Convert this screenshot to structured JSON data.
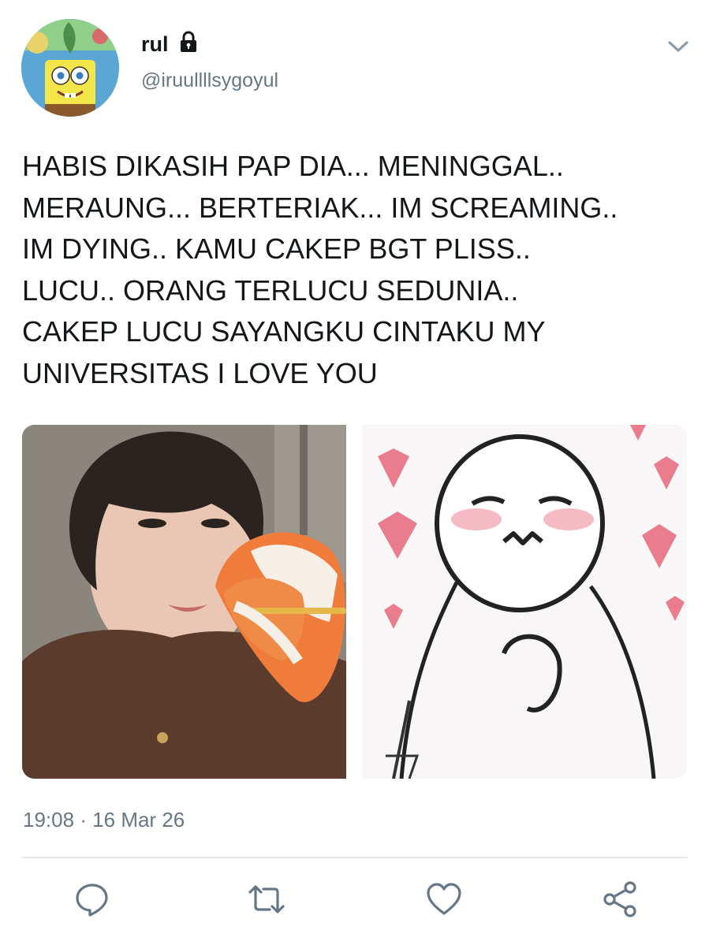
{
  "tweet": {
    "display_name": "rul",
    "handle": "@iruullllsygoyul",
    "text": "HABIS DIKASIH PAP DIA... MENINGGAL..\nMERAUNG... BERTERIAK... IM SCREAMING..\nIM DYING.. KAMU CAKEP BGT PLISS..\nLUCU.. ORANG TERLUCU SEDUNIA..\nCAKEP LUCU SAYANGKU CINTAKU MY\nUNIVERSITAS I LOVE YOU",
    "timestamp": "19:08 · 16 Mar 26",
    "protected": true
  },
  "icons": {
    "lock": "lock-icon",
    "menu": "chevron-down-icon",
    "reply": "reply-icon",
    "retweet": "retweet-icon",
    "like": "heart-icon",
    "share": "share-icon"
  },
  "colors": {
    "text": "#14171a",
    "secondary": "#657786",
    "divider": "#e1e8ed",
    "icon": "#657786"
  }
}
